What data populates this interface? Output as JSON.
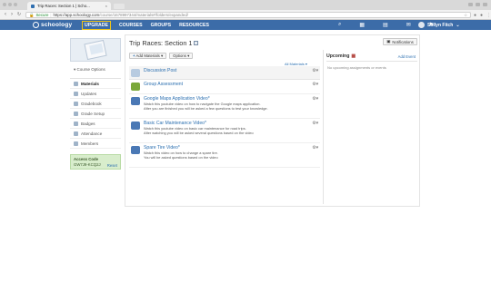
{
  "browser": {
    "tab_title": "Trip Races: Section 1 | Scho...",
    "tab_close": "×",
    "back": "‹",
    "forward": "›",
    "reload": "↻",
    "secure_label": "Secure",
    "url_host": "https://app.schoology.com",
    "url_path": "/course/1678997344/materials#/folders/expanded/",
    "star": "☆",
    "menu": "⋮"
  },
  "navbar": {
    "logo": "schoology",
    "links": [
      "UPGRADE",
      "COURSES",
      "GROUPS",
      "RESOURCES"
    ],
    "user_name": "Sollyn Fitch",
    "user_caret": "⌄",
    "icons": [
      "search-icon",
      "apps-icon",
      "calendar-icon",
      "messages-icon",
      "notifications-icon"
    ]
  },
  "sidebar": {
    "course_options": "▾ Course Options",
    "items": [
      {
        "label": "Materials",
        "icon": "materials-icon",
        "active": true
      },
      {
        "label": "Updates",
        "icon": "updates-icon",
        "active": false
      },
      {
        "label": "Gradebook",
        "icon": "gradebook-icon",
        "active": false
      },
      {
        "label": "Grade Setup",
        "icon": "grade-setup-icon",
        "active": false
      },
      {
        "label": "Badges",
        "icon": "badges-icon",
        "active": false
      },
      {
        "label": "Attendance",
        "icon": "attendance-icon",
        "active": false
      },
      {
        "label": "Members",
        "icon": "members-icon",
        "active": false
      }
    ],
    "access_code": {
      "heading": "Access Code",
      "code": "GW7J9-KCQ2J",
      "reset": "Reset"
    }
  },
  "main": {
    "title": "Trip Races: Section 1",
    "notifications_button": "Notifications",
    "add_materials": "Add Materials ▾",
    "options": "Options ▾",
    "all_materials": "All Materials ▾",
    "gear": "⚙▾",
    "items": [
      {
        "name": "Discussion Post",
        "desc": [],
        "icon": "discussion-icon",
        "color": "#b8cbe0"
      },
      {
        "name": "Group Assessment",
        "desc": [],
        "icon": "puzzle-icon",
        "color": "#7aa83a"
      },
      {
        "name": "Google Maps Application Video*",
        "desc": [
          "Watch this youtube video on how to navigate the Google maps application.",
          "After you are finished you will be asked a few questions to test your knowledge."
        ],
        "icon": "assignment-icon",
        "color": "#4a78b5"
      },
      {
        "name": "Basic Car Maintenance Video*",
        "desc": [
          "Watch this youtube video on basic car maintenance for road trips.",
          "After watching you will be asked several questions based on the video"
        ],
        "icon": "assignment-icon",
        "color": "#4a78b5"
      },
      {
        "name": "Spare Tire Video*",
        "desc": [
          "Watch this video on how to change a spare tire.",
          "You will be asked questions based on the video"
        ],
        "icon": "assignment-icon",
        "color": "#4a78b5"
      }
    ]
  },
  "upcoming": {
    "heading": "Upcoming",
    "add_event": "Add Event",
    "empty_text": "No upcoming assignments or events"
  },
  "colors": {
    "navbar": "#3c6ca8",
    "link": "#2b6fb0",
    "access_bg": "#d8edcc"
  }
}
